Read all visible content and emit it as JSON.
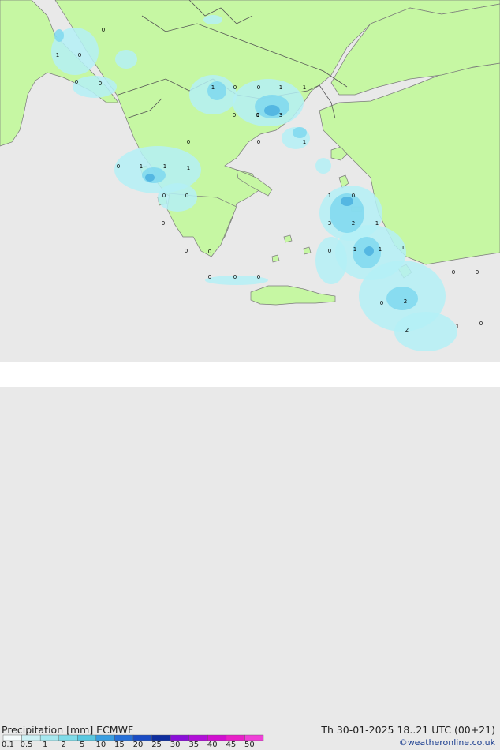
{
  "map": {
    "colors": {
      "land": "#c6f7a3",
      "sea": "#e9e9e9",
      "coast": "#7a7a7a",
      "border": "#555555",
      "precip_light": "#b4f0f6",
      "precip_mid": "#7fd8ee",
      "precip_heavy": "#4fb3e0"
    },
    "point_labels": [
      "0",
      "1",
      "0",
      "0",
      "0",
      "1",
      "0",
      "0",
      "1",
      "1",
      "0",
      "0",
      "1",
      "3",
      "1",
      "0",
      "0",
      "0",
      "1",
      "1",
      "1",
      "0",
      "0",
      "0",
      "0",
      "0",
      "1",
      "0",
      "3",
      "2",
      "1",
      "0",
      "1",
      "1",
      "1",
      "0",
      "0",
      "0",
      "0",
      "0",
      "2",
      "0",
      "2",
      "1",
      "0"
    ]
  },
  "legend": {
    "title": "Precipitation [mm]  ECMWF",
    "datetime": "Th 30-01-2025 18..21 UTC (00+21)",
    "credit": "©weatheronline.co.uk",
    "scale": [
      {
        "label": "0.1",
        "color": "#f5fbfc"
      },
      {
        "label": "0.5",
        "color": "#cdf1f5"
      },
      {
        "label": "1",
        "color": "#a6e8ef"
      },
      {
        "label": "2",
        "color": "#7fdbe8"
      },
      {
        "label": "5",
        "color": "#5ac8e0"
      },
      {
        "label": "10",
        "color": "#3a9ee0"
      },
      {
        "label": "15",
        "color": "#2770d8"
      },
      {
        "label": "20",
        "color": "#1a4cc4"
      },
      {
        "label": "25",
        "color": "#0f2e9e"
      },
      {
        "label": "30",
        "color": "#8a0fd8"
      },
      {
        "label": "35",
        "color": "#b10fd8"
      },
      {
        "label": "40",
        "color": "#d10fd0"
      },
      {
        "label": "45",
        "color": "#e820c8"
      },
      {
        "label": "50",
        "color": "#f040d8"
      }
    ]
  }
}
